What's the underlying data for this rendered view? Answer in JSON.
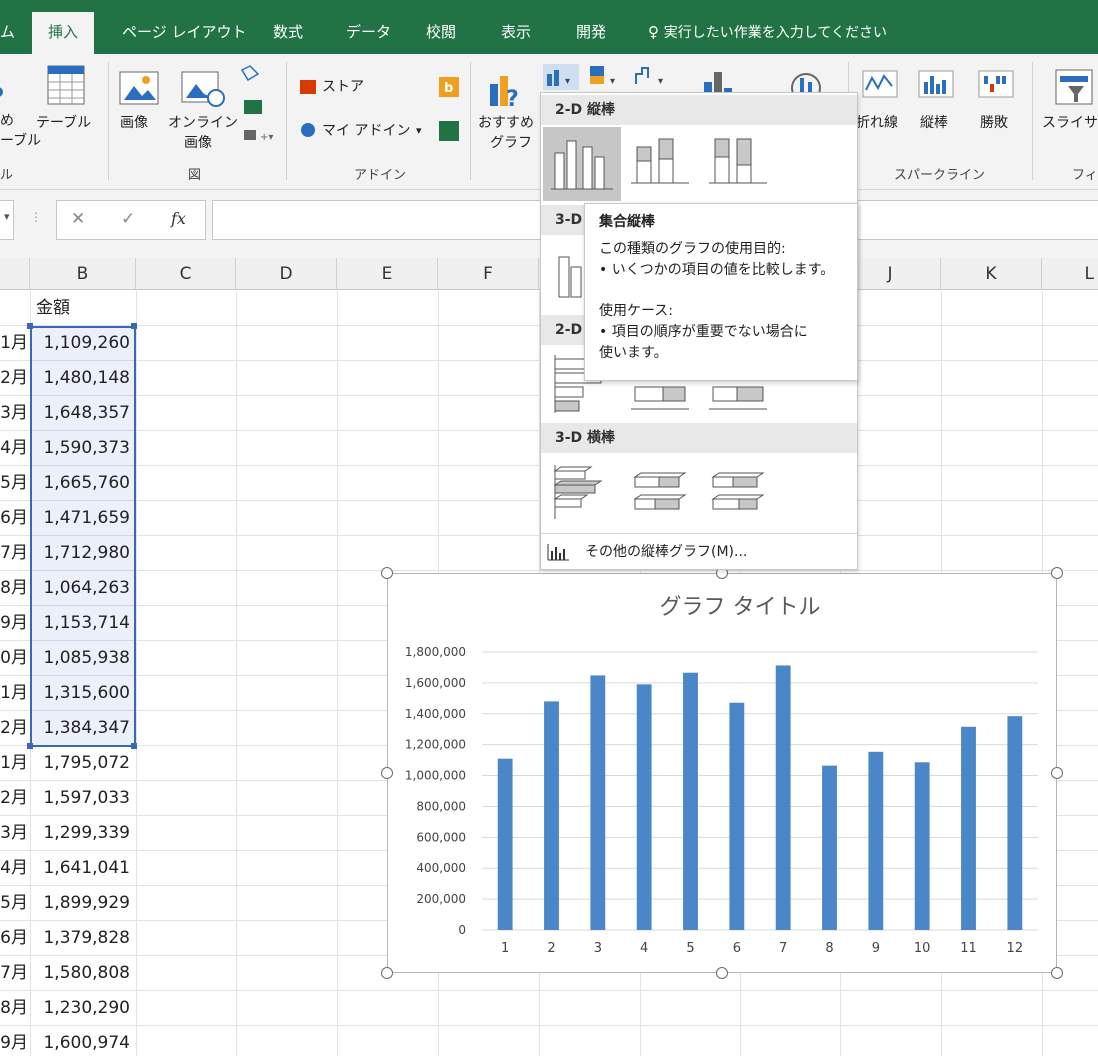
{
  "tabs": [
    "ム",
    "挿入",
    "ページ レイアウト",
    "数式",
    "データ",
    "校閲",
    "表示",
    "開発"
  ],
  "tell_me": "実行したい作業を入力してください",
  "ribbon": {
    "table_group": {
      "label_a": "め",
      "label_b": "ーブル",
      "table": "テーブル",
      "group": "ル"
    },
    "illustrations": {
      "image": "画像",
      "online1": "オンライン",
      "online2": "画像",
      "group": "図"
    },
    "addins": {
      "store": "ストア",
      "my_addins": "マイ アドイン",
      "group": "アドイン"
    },
    "charts": {
      "recommended1": "おすすめ",
      "recommended2": "グラフ"
    },
    "sparklines": {
      "line": "折れ線",
      "column": "縦棒",
      "winloss": "勝敗",
      "group": "スパークライン"
    },
    "filters": {
      "slicer": "スライサー",
      "group": "フィ"
    }
  },
  "formula_bar": {
    "cancel": "✕",
    "enter": "✓",
    "fx": "fx"
  },
  "columns": [
    "B",
    "C",
    "D",
    "E",
    "F",
    "J",
    "K",
    "L"
  ],
  "sheet": {
    "header_b": "金額",
    "rows": [
      {
        "a": "1月",
        "b": "1,109,260"
      },
      {
        "a": "2月",
        "b": "1,480,148"
      },
      {
        "a": "3月",
        "b": "1,648,357"
      },
      {
        "a": "4月",
        "b": "1,590,373"
      },
      {
        "a": "5月",
        "b": "1,665,760"
      },
      {
        "a": "6月",
        "b": "1,471,659"
      },
      {
        "a": "7月",
        "b": "1,712,980"
      },
      {
        "a": "8月",
        "b": "1,064,263"
      },
      {
        "a": "9月",
        "b": "1,153,714"
      },
      {
        "a": "0月",
        "b": "1,085,938"
      },
      {
        "a": "1月",
        "b": "1,315,600"
      },
      {
        "a": "2月",
        "b": "1,384,347"
      },
      {
        "a": "1月",
        "b": "1,795,072"
      },
      {
        "a": "2月",
        "b": "1,597,033"
      },
      {
        "a": "3月",
        "b": "1,299,339"
      },
      {
        "a": "4月",
        "b": "1,641,041"
      },
      {
        "a": "5月",
        "b": "1,899,929"
      },
      {
        "a": "6月",
        "b": "1,379,828"
      },
      {
        "a": "7月",
        "b": "1,580,808"
      },
      {
        "a": "8月",
        "b": "1,230,290"
      },
      {
        "a": "9月",
        "b": "1,600,974"
      }
    ]
  },
  "dropdown": {
    "sec_2d_col": "2-D 縦棒",
    "sec_3d_col_partial": "3-D",
    "sec_2d_bar_partial": "2-D",
    "sec_3d_bar": "3-D 横棒",
    "more": "その他の縦棒グラフ(M)..."
  },
  "tooltip": {
    "title": "集合縦棒",
    "purpose_heading": "この種類のグラフの使用目的:",
    "purpose_item": "• いくつかの項目の値を比較します。",
    "use_heading": "使用ケース:",
    "use_item1": "• 項目の順序が重要でない場合に",
    "use_item2": "使います。"
  },
  "chart_data": {
    "type": "bar",
    "title": "グラフ タイトル",
    "categories": [
      "1",
      "2",
      "3",
      "4",
      "5",
      "6",
      "7",
      "8",
      "9",
      "10",
      "11",
      "12"
    ],
    "values": [
      1109260,
      1480148,
      1648357,
      1590373,
      1665760,
      1471659,
      1712980,
      1064263,
      1153714,
      1085938,
      1315600,
      1384347
    ],
    "yticks": [
      "0",
      "200,000",
      "400,000",
      "600,000",
      "800,000",
      "1,000,000",
      "1,200,000",
      "1,400,000",
      "1,600,000",
      "1,800,000"
    ],
    "ylim": [
      0,
      1800000
    ],
    "grid": true,
    "color": "#4a86c8"
  }
}
